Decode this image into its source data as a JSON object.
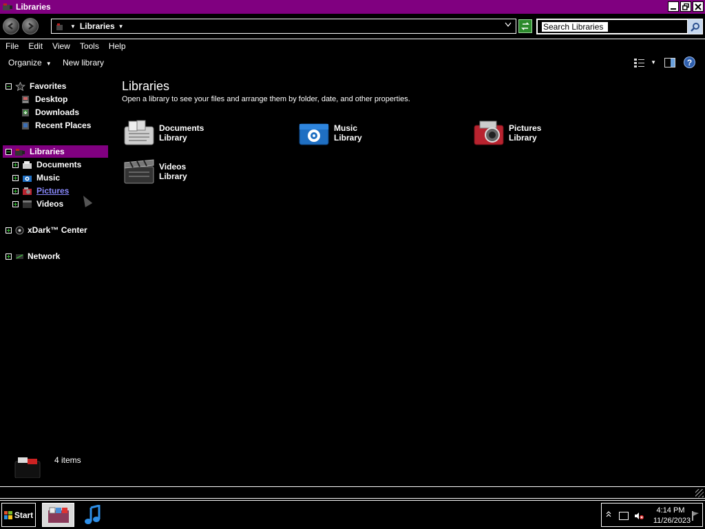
{
  "window": {
    "title": "Libraries"
  },
  "address": {
    "crumb": "Libraries",
    "search_placeholder": "Search Libraries"
  },
  "menu": [
    "File",
    "Edit",
    "View",
    "Tools",
    "Help"
  ],
  "command": {
    "organize": "Organize",
    "new_library": "New library"
  },
  "nav": {
    "favorites": "Favorites",
    "desktop": "Desktop",
    "downloads": "Downloads",
    "recent": "Recent Places",
    "libraries": "Libraries",
    "documents": "Documents",
    "music": "Music",
    "pictures": "Pictures",
    "videos": "Videos",
    "xdark": "xDark™ Center",
    "network": "Network"
  },
  "main": {
    "title": "Libraries",
    "subtitle": "Open a library to see your files and arrange them by folder, date, and other properties.",
    "libraries": [
      {
        "name": "Documents",
        "kind": "Library"
      },
      {
        "name": "Music",
        "kind": "Library"
      },
      {
        "name": "Pictures",
        "kind": "Library"
      },
      {
        "name": "Videos",
        "kind": "Library"
      }
    ]
  },
  "details": {
    "count": "4 items"
  },
  "taskbar": {
    "start": "Start",
    "time": "4:14 PM",
    "date": "11/26/2023"
  },
  "colors": {
    "accent": "#800080",
    "background": "#000000",
    "text": "#ffffff",
    "link": "#8a8aff"
  }
}
